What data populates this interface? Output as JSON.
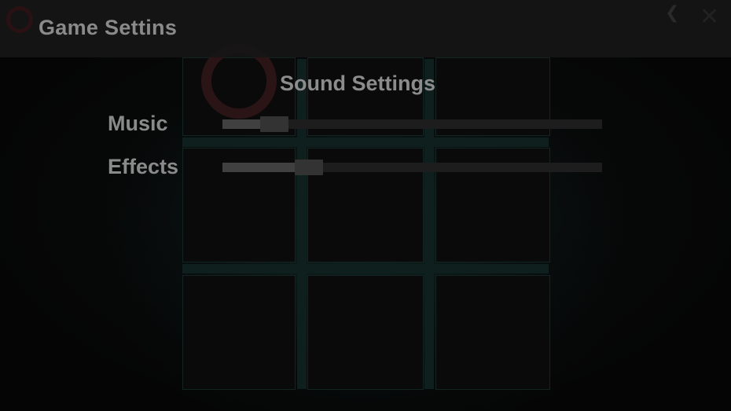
{
  "header": {
    "title": "Game Settins",
    "back_icon": "chevron-left-icon",
    "close_icon": "close-icon"
  },
  "sound": {
    "title": "Sound Settings",
    "music": {
      "label": "Music",
      "value_percent": 10
    },
    "effects": {
      "label": "Effects",
      "value_percent": 19
    }
  },
  "colors": {
    "background": "#050505",
    "board_accent": "#132523",
    "ring_accent": "#2b1416",
    "text": "#8a8a8a",
    "slider_track": "#1d1d1d",
    "slider_fill": "#404040"
  }
}
